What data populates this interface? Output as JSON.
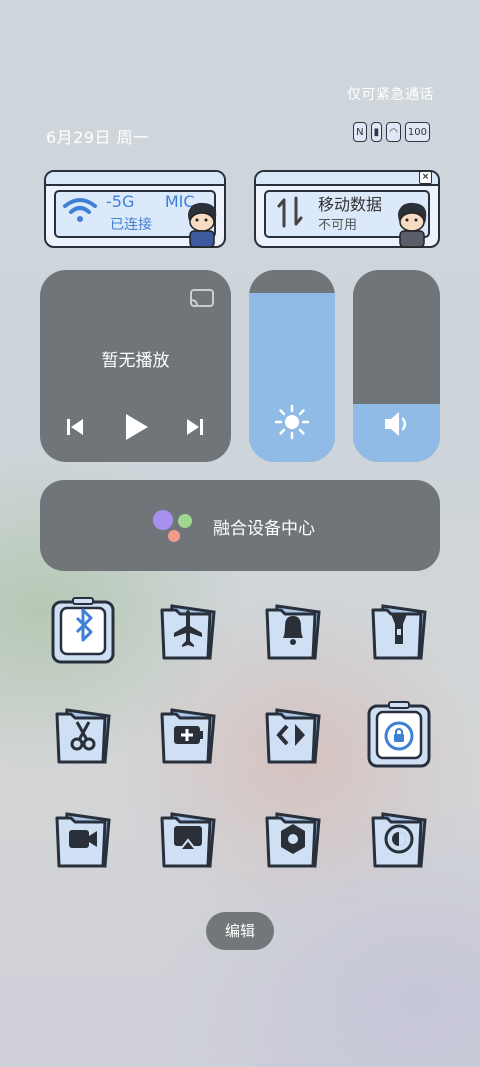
{
  "status_bar": {
    "emergency_text": "仅可紧急通话",
    "date_text": "6月29日 周一",
    "icons": [
      "nfc-icon",
      "signal-icon",
      "wifi-icon",
      "battery-icon"
    ],
    "battery_level": "100"
  },
  "wifi_card": {
    "ssid": "-5G",
    "ssid_suffix": "MIC",
    "status": "已连接"
  },
  "data_card": {
    "title": "移动数据",
    "status": "不可用"
  },
  "media": {
    "title": "暂无播放"
  },
  "brightness": {
    "level": 0.88
  },
  "volume": {
    "level": 0.3
  },
  "fusion": {
    "label": "融合设备中心"
  },
  "quick_settings": [
    {
      "name": "bluetooth-icon",
      "active": true
    },
    {
      "name": "airplane-icon",
      "active": false
    },
    {
      "name": "bell-icon",
      "active": false
    },
    {
      "name": "flashlight-icon",
      "active": false
    },
    {
      "name": "screenshot-icon",
      "active": false
    },
    {
      "name": "battery-saver-icon",
      "active": false
    },
    {
      "name": "code-icon",
      "active": false
    },
    {
      "name": "rotation-lock-icon",
      "active": true
    },
    {
      "name": "screen-record-icon",
      "active": false
    },
    {
      "name": "screen-cast-icon",
      "active": false
    },
    {
      "name": "settings-icon",
      "active": false
    },
    {
      "name": "dark-mode-icon",
      "active": false
    }
  ],
  "edit_label": "编辑",
  "colors": {
    "accent": "#8fbbe6",
    "tile": "#6f7579",
    "outline": "#27303c"
  }
}
